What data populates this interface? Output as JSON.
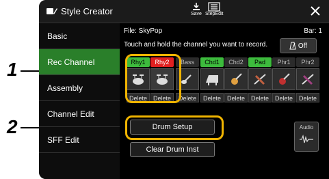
{
  "callouts": [
    "1",
    "2"
  ],
  "title": "Style Creator",
  "toolbar": {
    "save_label": "Save",
    "stepedit_label": "StepEdit"
  },
  "sidebar": {
    "items": [
      {
        "label": "Basic"
      },
      {
        "label": "Rec Channel"
      },
      {
        "label": "Assembly"
      },
      {
        "label": "Channel Edit"
      },
      {
        "label": "SFF Edit"
      }
    ],
    "active_index": 1
  },
  "main": {
    "file": "File: SkyPop",
    "bar": "Bar:  1",
    "hint": "Touch and hold the channel you want to record.",
    "metronome_label": "Off",
    "channels": [
      {
        "label": "Rhy1",
        "state": "on",
        "icon": "drum-kit-icon"
      },
      {
        "label": "Rhy2",
        "state": "rec",
        "icon": "drum-kit-icon"
      },
      {
        "label": "Bass",
        "state": "off",
        "icon": "bass-guitar-icon"
      },
      {
        "label": "Chd1",
        "state": "on",
        "icon": "piano-icon"
      },
      {
        "label": "Chd2",
        "state": "off",
        "icon": "guitar-icon"
      },
      {
        "label": "Pad",
        "state": "on",
        "icon": "strings-icon"
      },
      {
        "label": "Phr1",
        "state": "off",
        "icon": "guitar-icon"
      },
      {
        "label": "Phr2",
        "state": "off",
        "icon": "strings-icon"
      }
    ],
    "delete_label": "Delete",
    "drum_setup_label": "Drum Setup",
    "clear_drum_label": "Clear Drum Inst",
    "audio_label": "Audio"
  },
  "accent_colors": {
    "green": "#3dbb3d",
    "red": "#e02020",
    "highlight": "#f0b400",
    "active_tab": "#2a7f2a"
  }
}
